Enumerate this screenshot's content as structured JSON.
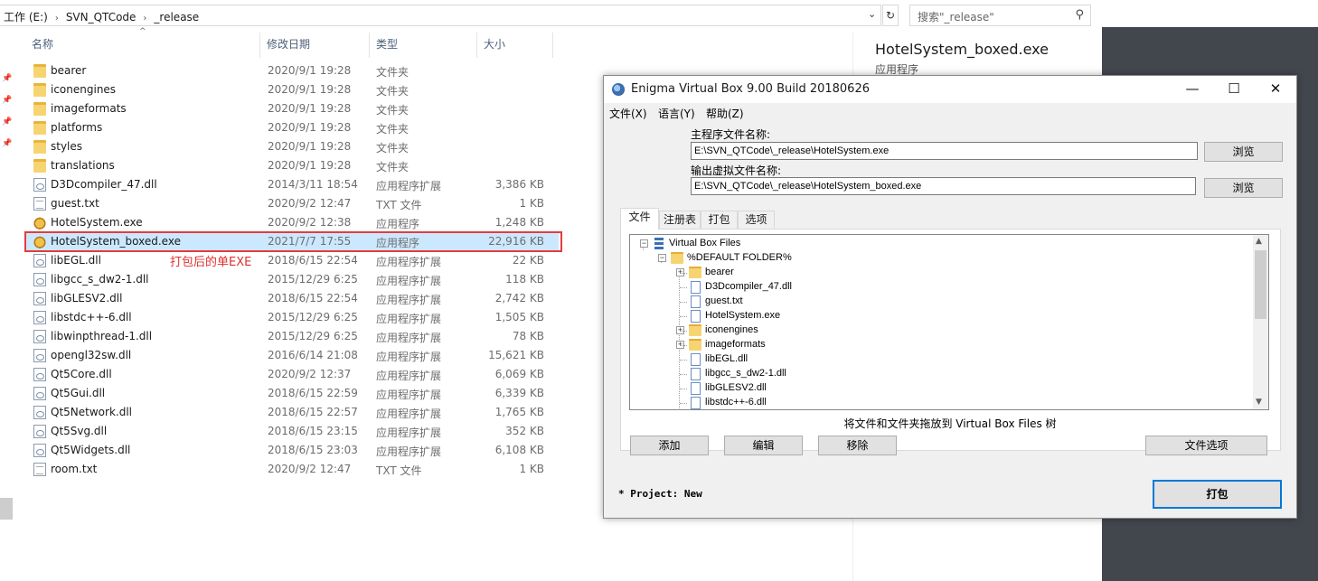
{
  "explorer": {
    "breadcrumb": [
      "工作 (E:)",
      "SVN_QTCode",
      "_release"
    ],
    "search_placeholder": "搜索\"_release\"",
    "columns": {
      "name": "名称",
      "date": "修改日期",
      "type": "类型",
      "size": "大小"
    },
    "files": [
      {
        "name": "bearer",
        "date": "2020/9/1 19:28",
        "type": "文件夹",
        "size": "",
        "icon": "folder"
      },
      {
        "name": "iconengines",
        "date": "2020/9/1 19:28",
        "type": "文件夹",
        "size": "",
        "icon": "folder"
      },
      {
        "name": "imageformats",
        "date": "2020/9/1 19:28",
        "type": "文件夹",
        "size": "",
        "icon": "folder"
      },
      {
        "name": "platforms",
        "date": "2020/9/1 19:28",
        "type": "文件夹",
        "size": "",
        "icon": "folder"
      },
      {
        "name": "styles",
        "date": "2020/9/1 19:28",
        "type": "文件夹",
        "size": "",
        "icon": "folder"
      },
      {
        "name": "translations",
        "date": "2020/9/1 19:28",
        "type": "文件夹",
        "size": "",
        "icon": "folder"
      },
      {
        "name": "D3Dcompiler_47.dll",
        "date": "2014/3/11 18:54",
        "type": "应用程序扩展",
        "size": "3,386 KB",
        "icon": "dll"
      },
      {
        "name": "guest.txt",
        "date": "2020/9/2 12:47",
        "type": "TXT 文件",
        "size": "1 KB",
        "icon": "txt"
      },
      {
        "name": "HotelSystem.exe",
        "date": "2020/9/2 12:38",
        "type": "应用程序",
        "size": "1,248 KB",
        "icon": "exe"
      },
      {
        "name": "HotelSystem_boxed.exe",
        "date": "2021/7/7 17:55",
        "type": "应用程序",
        "size": "22,916 KB",
        "icon": "exe",
        "selected": true
      },
      {
        "name": "libEGL.dll",
        "date": "2018/6/15 22:54",
        "type": "应用程序扩展",
        "size": "22 KB",
        "icon": "dll"
      },
      {
        "name": "libgcc_s_dw2-1.dll",
        "date": "2015/12/29 6:25",
        "type": "应用程序扩展",
        "size": "118 KB",
        "icon": "dll"
      },
      {
        "name": "libGLESV2.dll",
        "date": "2018/6/15 22:54",
        "type": "应用程序扩展",
        "size": "2,742 KB",
        "icon": "dll"
      },
      {
        "name": "libstdc++-6.dll",
        "date": "2015/12/29 6:25",
        "type": "应用程序扩展",
        "size": "1,505 KB",
        "icon": "dll"
      },
      {
        "name": "libwinpthread-1.dll",
        "date": "2015/12/29 6:25",
        "type": "应用程序扩展",
        "size": "78 KB",
        "icon": "dll"
      },
      {
        "name": "opengl32sw.dll",
        "date": "2016/6/14 21:08",
        "type": "应用程序扩展",
        "size": "15,621 KB",
        "icon": "dll"
      },
      {
        "name": "Qt5Core.dll",
        "date": "2020/9/2 12:37",
        "type": "应用程序扩展",
        "size": "6,069 KB",
        "icon": "dll"
      },
      {
        "name": "Qt5Gui.dll",
        "date": "2018/6/15 22:59",
        "type": "应用程序扩展",
        "size": "6,339 KB",
        "icon": "dll"
      },
      {
        "name": "Qt5Network.dll",
        "date": "2018/6/15 22:57",
        "type": "应用程序扩展",
        "size": "1,765 KB",
        "icon": "dll"
      },
      {
        "name": "Qt5Svg.dll",
        "date": "2018/6/15 23:15",
        "type": "应用程序扩展",
        "size": "352 KB",
        "icon": "dll"
      },
      {
        "name": "Qt5Widgets.dll",
        "date": "2018/6/15 23:03",
        "type": "应用程序扩展",
        "size": "6,108 KB",
        "icon": "dll"
      },
      {
        "name": "room.txt",
        "date": "2020/9/2 12:47",
        "type": "TXT 文件",
        "size": "1 KB",
        "icon": "txt"
      }
    ],
    "annotation": "打包后的单EXE",
    "preview": {
      "title": "HotelSystem_boxed.exe",
      "subtitle": "应用程序"
    }
  },
  "enigma": {
    "title": "Enigma Virtual Box 9.00 Build 20180626",
    "controls": {
      "minimize": "—",
      "maximize": "☐",
      "close": "✕"
    },
    "menu": [
      "文件(X)",
      "语言(Y)",
      "帮助(Z)"
    ],
    "main_label": "主程序文件名称:",
    "main_path": "E:\\SVN_QTCode\\_release\\HotelSystem.exe",
    "output_label": "输出虚拟文件名称:",
    "output_path": "E:\\SVN_QTCode\\_release\\HotelSystem_boxed.exe",
    "browse": "浏览",
    "tabs": [
      "文件",
      "注册表",
      "打包",
      "选项"
    ],
    "tree": {
      "root": "Virtual Box Files",
      "default_folder": "%DEFAULT FOLDER%",
      "items": [
        {
          "label": "bearer",
          "kind": "folder"
        },
        {
          "label": "D3Dcompiler_47.dll",
          "kind": "file"
        },
        {
          "label": "guest.txt",
          "kind": "file"
        },
        {
          "label": "HotelSystem.exe",
          "kind": "file"
        },
        {
          "label": "iconengines",
          "kind": "folder"
        },
        {
          "label": "imageformats",
          "kind": "folder"
        },
        {
          "label": "libEGL.dll",
          "kind": "file"
        },
        {
          "label": "libgcc_s_dw2-1.dll",
          "kind": "file"
        },
        {
          "label": "libGLESV2.dll",
          "kind": "file"
        },
        {
          "label": "libstdc++-6.dll",
          "kind": "file"
        }
      ]
    },
    "drop_hint": "将文件和文件夹拖放到 Virtual Box Files 树",
    "buttons": {
      "add": "添加",
      "edit": "编辑",
      "remove": "移除",
      "file_options": "文件选项",
      "pack": "打包"
    },
    "project_status": "* Project: New"
  }
}
